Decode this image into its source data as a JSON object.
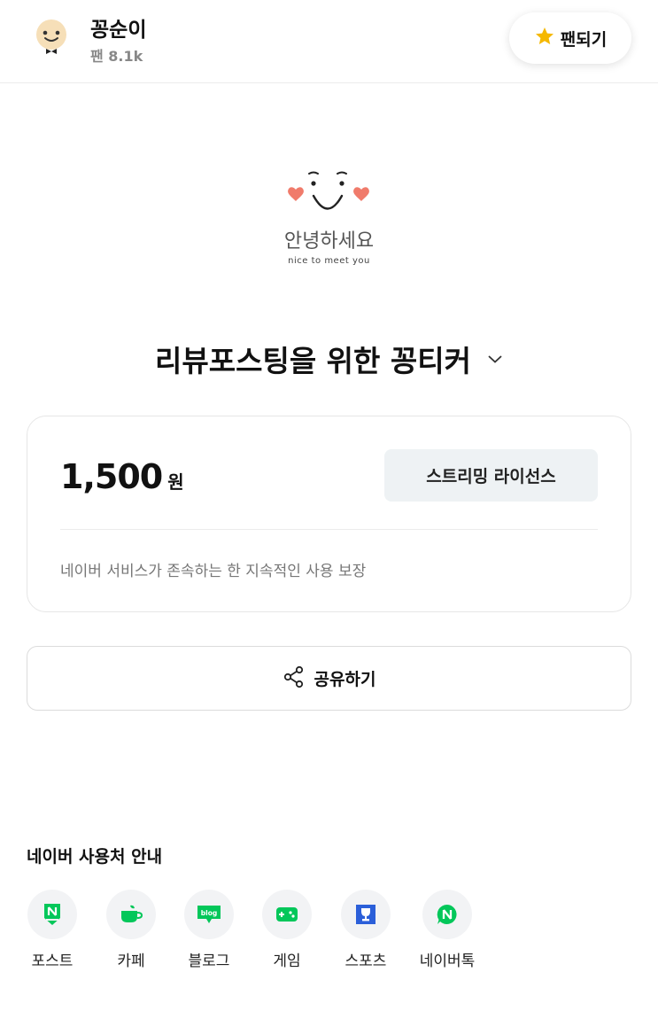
{
  "header": {
    "creator_name": "꽁순이",
    "fan_count": "팬 8.1k",
    "fan_button_label": "팬되기"
  },
  "hero": {
    "greeting": "안녕하세요",
    "subtitle": "nice to meet you"
  },
  "sticker": {
    "title": "리뷰포스팅을 위한 꽁티커"
  },
  "price_card": {
    "price": "1,500",
    "unit": "원",
    "license_label": "스트리밍 라이선스",
    "guarantee_text": "네이버 서비스가 존속하는 한 지속적인 사용 보장"
  },
  "share": {
    "label": "공유하기"
  },
  "services": {
    "section_title": "네이버 사용처 안내",
    "items": [
      {
        "label": "포스트",
        "icon": "post-icon"
      },
      {
        "label": "카페",
        "icon": "cafe-icon"
      },
      {
        "label": "블로그",
        "icon": "blog-icon"
      },
      {
        "label": "게임",
        "icon": "game-icon"
      },
      {
        "label": "스포츠",
        "icon": "sports-icon"
      },
      {
        "label": "네이버톡",
        "icon": "navertalk-icon"
      }
    ],
    "blog_icon_text": "blog"
  },
  "colors": {
    "naver_green": "#03c75a",
    "sports_blue": "#2b5fd9",
    "star_yellow": "#f5b800",
    "heart_red": "#f07b6b"
  }
}
